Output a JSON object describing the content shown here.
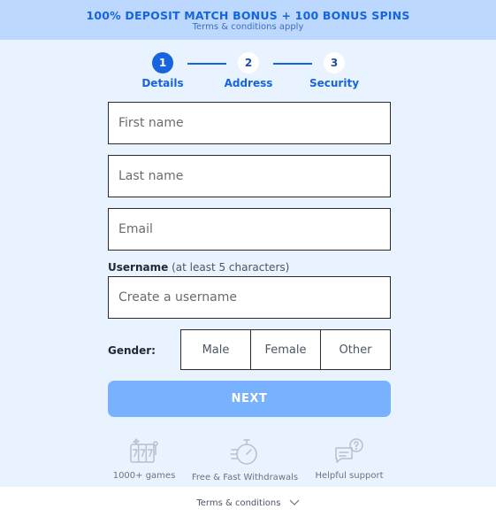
{
  "banner": {
    "title": "100% DEPOSIT MATCH BONUS + 100 BONUS SPINS",
    "subtitle": "Terms & conditions apply"
  },
  "steps": [
    {
      "number": "1",
      "label": "Details",
      "state": "active"
    },
    {
      "number": "2",
      "label": "Address",
      "state": "upcoming"
    },
    {
      "number": "3",
      "label": "Security",
      "state": "upcoming"
    }
  ],
  "form": {
    "first_name": {
      "placeholder": "First name",
      "value": ""
    },
    "last_name": {
      "placeholder": "Last name",
      "value": ""
    },
    "email": {
      "placeholder": "Email",
      "value": ""
    },
    "username": {
      "label": "Username",
      "hint": "(at least 5 characters)",
      "placeholder": "Create a username",
      "value": ""
    },
    "gender": {
      "label": "Gender:",
      "options": [
        "Male",
        "Female",
        "Other"
      ]
    },
    "next_label": "NEXT"
  },
  "features": [
    {
      "icon": "slot-machine-icon",
      "label": "1000+ games"
    },
    {
      "icon": "stopwatch-icon",
      "label": "Free & Fast Withdrawals"
    },
    {
      "icon": "chat-support-icon",
      "label": "Helpful support"
    }
  ],
  "footer": {
    "link_label": "Terms & conditions"
  },
  "colors": {
    "accent": "#1565e0",
    "button": "#78b2ff",
    "background": "#e9f2ff",
    "banner": "#bcd8ff"
  }
}
